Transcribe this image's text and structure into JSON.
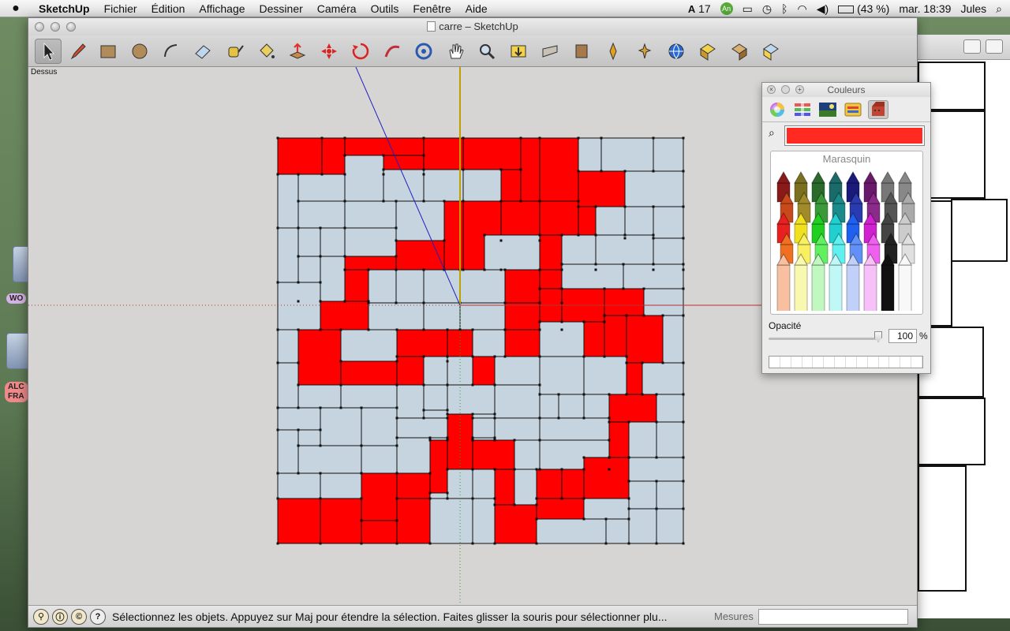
{
  "menubar": {
    "apple_icon": "apple-icon",
    "items": [
      "SketchUp",
      "Fichier",
      "Édition",
      "Affichage",
      "Dessiner",
      "Caméra",
      "Outils",
      "Fenêtre",
      "Aide"
    ],
    "status": {
      "input_badge": "17",
      "battery_percent": "(43 %)",
      "clock": "mar. 18:39",
      "user": "Jules"
    }
  },
  "desktop": {
    "labels": [
      "WO",
      "ALC FRA"
    ]
  },
  "window": {
    "title": "carre – SketchUp",
    "scene_label": "Dessus",
    "tools": [
      {
        "name": "select-tool",
        "icon": "arrow-cursor-icon",
        "selected": true
      },
      {
        "name": "pencil-tool",
        "icon": "pencil-icon"
      },
      {
        "name": "rectangle-tool",
        "icon": "rectangle-icon"
      },
      {
        "name": "circle-tool",
        "icon": "circle-icon"
      },
      {
        "name": "arc-tool",
        "icon": "arc-icon"
      },
      {
        "name": "eraser-tool",
        "icon": "eraser-icon"
      },
      {
        "name": "tape-measure-tool",
        "icon": "tape-measure-icon"
      },
      {
        "name": "paint-bucket-tool",
        "icon": "paint-bucket-icon"
      },
      {
        "name": "push-pull-tool",
        "icon": "push-pull-icon"
      },
      {
        "name": "move-tool",
        "icon": "move-icon"
      },
      {
        "name": "rotate-tool",
        "icon": "rotate-icon"
      },
      {
        "name": "follow-me-tool",
        "icon": "follow-me-icon"
      },
      {
        "name": "orbit-tool",
        "icon": "orbit-icon"
      },
      {
        "name": "pan-tool",
        "icon": "hand-icon"
      },
      {
        "name": "zoom-tool",
        "icon": "magnifier-icon"
      },
      {
        "name": "zoom-extents-tool",
        "icon": "zoom-extents-icon"
      },
      {
        "name": "previous-view-tool",
        "icon": "previous-view-icon"
      },
      {
        "name": "next-view-tool",
        "icon": "next-view-icon"
      },
      {
        "name": "position-camera-tool",
        "icon": "position-camera-icon"
      },
      {
        "name": "walk-tool",
        "icon": "walk-icon"
      },
      {
        "name": "google-earth-tool",
        "icon": "globe-icon"
      },
      {
        "name": "get-models-tool",
        "icon": "get-models-icon"
      },
      {
        "name": "share-model-tool",
        "icon": "share-model-icon"
      },
      {
        "name": "components-tool",
        "icon": "components-icon"
      }
    ],
    "status_text": "Sélectionnez les objets. Appuyez sur Maj pour étendre la sélection. Faites glisser la souris pour sélectionner plu...",
    "measures_label": "Mesures",
    "measures_value": ""
  },
  "colors_panel": {
    "title": "Couleurs",
    "modes": [
      "color-wheel-icon",
      "color-sliders-icon",
      "color-palettes-icon",
      "image-palettes-icon",
      "crayons-icon"
    ],
    "current_color": "#ff2a21",
    "crayon_name": "Marasquin",
    "opacity_label": "Opacité",
    "opacity_value": "100",
    "opacity_unit": "%"
  },
  "colors": {
    "red": "#ff0000",
    "light": "#c5d4de",
    "viewport_bg": "#d6d5d3"
  }
}
